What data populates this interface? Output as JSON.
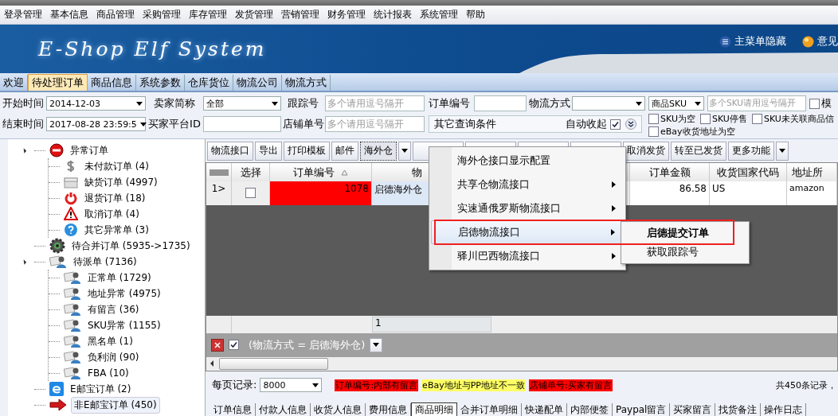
{
  "menu_bar": [
    "登录管理",
    "基本信息",
    "商品管理",
    "采购管理",
    "库存管理",
    "发货管理",
    "营销管理",
    "财务管理",
    "统计报表",
    "系统管理",
    "帮助"
  ],
  "banner": {
    "logo": "E-Shop Elf System",
    "links": [
      {
        "label": "主菜单隐藏",
        "kind": "list"
      },
      {
        "label": "意见",
        "kind": "orb"
      }
    ]
  },
  "tabs": [
    {
      "label": "欢迎",
      "selected": false
    },
    {
      "label": "待处理订单",
      "selected": true
    },
    {
      "label": "商品信息",
      "selected": false
    },
    {
      "label": "系统参数",
      "selected": false
    },
    {
      "label": "仓库货位",
      "selected": false
    },
    {
      "label": "物流公司",
      "selected": false
    },
    {
      "label": "物流方式",
      "selected": false
    }
  ],
  "filters": {
    "start_time": {
      "label": "开始时间",
      "value": "2014-12-03"
    },
    "end_time": {
      "label": "结束时间",
      "value": "2017-08-28 23:59:5"
    },
    "seller": {
      "label": "卖家简称",
      "value": "全部"
    },
    "buyer_id": {
      "label": "买家平台ID"
    },
    "tracking": {
      "label": "跟踪号",
      "placeholder": "多个请用逗号隔开"
    },
    "store_no": {
      "label": "店铺单号",
      "placeholder": "多个请用逗号隔开"
    },
    "order_no": {
      "label": "订单编号"
    },
    "shipping": {
      "label": "物流方式"
    },
    "other": {
      "label": "其它查询条件"
    },
    "auto_collapse": {
      "label": "自动收起",
      "checked": true
    },
    "sku_select": {
      "value": "商品SKU"
    },
    "sku_field": {
      "placeholder": "多个SKU请用逗号隔开"
    },
    "fuzzy": {
      "label": "模",
      "checked": false
    },
    "checks": [
      {
        "label": "SKU为空",
        "checked": false
      },
      {
        "label": "SKU停售",
        "checked": false
      },
      {
        "label": "SKU未关联商品信",
        "checked": false
      },
      {
        "label": "eBay收货地址为空",
        "checked": false
      }
    ]
  },
  "tree": [
    {
      "label": "异常订单",
      "kind": "stop",
      "selected": false,
      "expanded": true,
      "children": [
        {
          "label": "未付款订单 (4)",
          "kind": "dollar",
          "selected": false
        },
        {
          "label": "缺货订单 (4997)",
          "kind": "box",
          "selected": false
        },
        {
          "label": "退货订单 (18)",
          "kind": "power",
          "selected": false
        },
        {
          "label": "取消订单 (4)",
          "kind": "warning",
          "selected": false
        },
        {
          "label": "其它异常单 (3)",
          "kind": "help",
          "selected": false
        }
      ]
    },
    {
      "label": "待合并订单 (5935->1735)",
      "kind": "gear",
      "selected": false
    },
    {
      "label": "待派单 (7136)",
      "kind": "users",
      "selected": false,
      "expanded": true,
      "children": [
        {
          "label": "正常单 (1729)",
          "kind": "users",
          "selected": false
        },
        {
          "label": "地址异常 (4975)",
          "kind": "users",
          "selected": false
        },
        {
          "label": "有留言 (36)",
          "kind": "users",
          "selected": false
        },
        {
          "label": "SKU异常 (1155)",
          "kind": "users",
          "selected": false
        },
        {
          "label": "黑名单 (1)",
          "kind": "users",
          "selected": false
        },
        {
          "label": "负利润 (90)",
          "kind": "users",
          "selected": false
        },
        {
          "label": "FBA (10)",
          "kind": "users",
          "selected": false
        }
      ]
    },
    {
      "label": "E邮宝订单 (2)",
      "kind": "ebox",
      "selected": false
    },
    {
      "label": "非E邮宝订单 (450)",
      "kind": "arrow",
      "selected": true
    }
  ],
  "toolbar": [
    {
      "label": "物流接口",
      "selected": false
    },
    {
      "label": "导出",
      "selected": false
    },
    {
      "label": "打印模板",
      "selected": false
    },
    {
      "label": "邮件",
      "selected": false
    },
    {
      "label": "海外仓",
      "selected": true,
      "kind": "split"
    },
    {
      "kind": "covered",
      "selected": false
    },
    {
      "kind": "covered",
      "selected": false
    },
    {
      "kind": "covered",
      "selected": false
    },
    {
      "kind": "covered",
      "selected": false
    },
    {
      "label": "取消发货",
      "selected": false
    },
    {
      "label": "转至已发货",
      "selected": false
    },
    {
      "label": "更多功能",
      "selected": false,
      "kind": "split"
    }
  ],
  "grid": {
    "columns": {
      "select": "选择",
      "order_no": "订单编号",
      "shipping": "物",
      "amount": "订单金额",
      "country": "收货国家代码",
      "address": "地址所"
    },
    "sorted_ascending": true,
    "rows": [
      {
        "number": "1>",
        "checked": false,
        "order_no": "1078",
        "has_internal_note": true,
        "shipping": "启德海外仓",
        "amount": "86.58",
        "country": "US",
        "address": "amazon"
      }
    ],
    "summary": "1"
  },
  "filter_bar": {
    "checked": true,
    "text": "(物流方式 = 启德海外仓)"
  },
  "page_size": {
    "label": "每页记录:",
    "value": "8000"
  },
  "legend": [
    {
      "label": "订单编号:内部有留言",
      "color": "#ff0000"
    },
    {
      "label": "eBay地址与PP地址不一致",
      "color": "#ffff66"
    },
    {
      "label": "店铺单号:买家有留言",
      "color": "#ff0000"
    }
  ],
  "record_count": "共450条记录，",
  "detail_tabs": [
    {
      "label": "订单信息",
      "selected": false
    },
    {
      "label": "付款人信息",
      "selected": false
    },
    {
      "label": "收货人信息",
      "selected": false
    },
    {
      "label": "费用信息",
      "selected": false
    },
    {
      "label": "商品明细",
      "selected": true
    },
    {
      "label": "合并订单明细",
      "selected": false
    },
    {
      "label": "快递配单",
      "selected": false
    },
    {
      "label": "内部便签",
      "selected": false
    },
    {
      "label": "Paypal留言",
      "selected": false
    },
    {
      "label": "买家留言",
      "selected": false
    },
    {
      "label": "找货备注",
      "selected": false
    },
    {
      "label": "操作日志",
      "selected": false
    }
  ],
  "context_menu": {
    "items": [
      {
        "label": "海外仓接口显示配置",
        "has_submenu": false,
        "selected": false
      },
      {
        "label": "共享仓物流接口",
        "has_submenu": true,
        "selected": false
      },
      {
        "label": "实速通俄罗斯物流接口",
        "has_submenu": true,
        "selected": false
      },
      {
        "label": "启德物流接口",
        "has_submenu": true,
        "selected": true
      },
      {
        "label": "驿川巴西物流接口",
        "has_submenu": true,
        "selected": false
      }
    ],
    "submenu": [
      {
        "label": "启德提交订单",
        "selected": true
      },
      {
        "label": "获取跟踪号",
        "selected": false
      }
    ]
  }
}
